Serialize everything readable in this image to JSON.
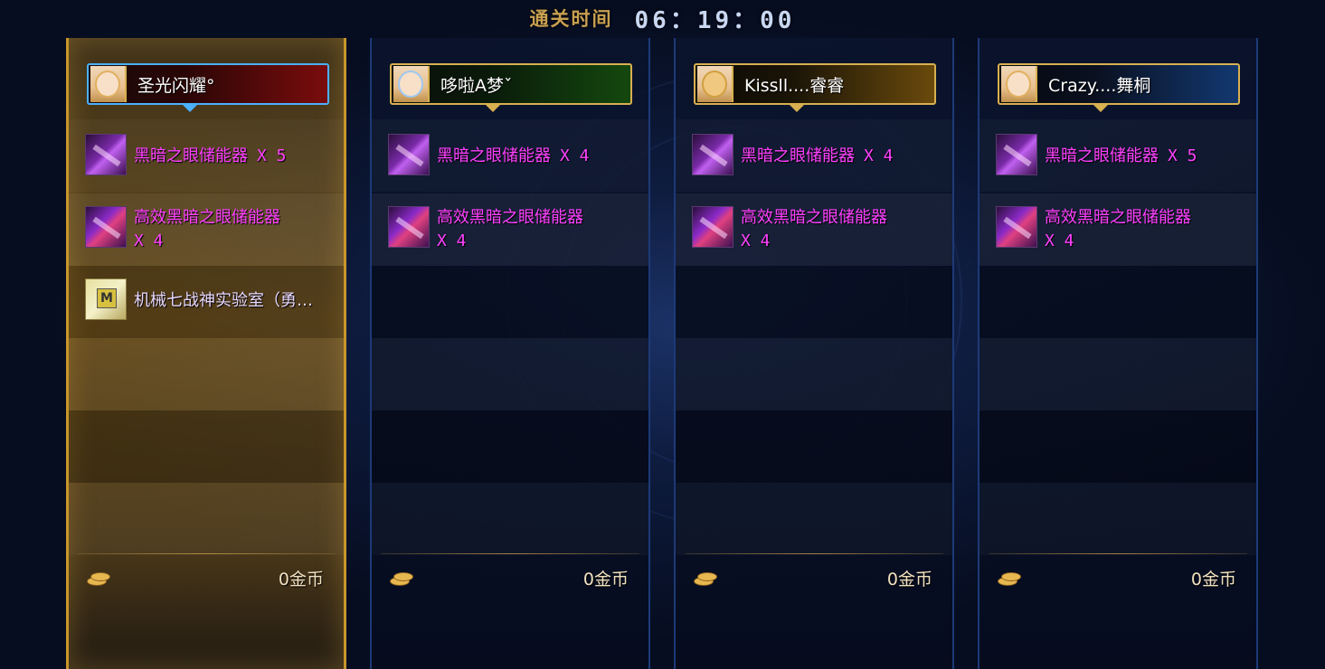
{
  "header": {
    "clear_label": "通关时间",
    "clear_time": "06：19：00"
  },
  "players": [
    {
      "name": "圣光闪耀°",
      "selected": true,
      "items": [
        {
          "name": "黑暗之眼储能器",
          "qty": "X 5",
          "icon": "dark-eye-storage-icon"
        },
        {
          "name": "高效黑暗之眼储能器",
          "qty": "X 4",
          "icon": "efficient-dark-eye-storage-icon"
        },
        {
          "name": "机械七战神实验室（勇…",
          "qty": "",
          "icon": "map-scroll-icon"
        }
      ],
      "gold": "0金币"
    },
    {
      "name": "哆啦A梦ˇ",
      "selected": false,
      "items": [
        {
          "name": "黑暗之眼储能器",
          "qty": "X 4",
          "icon": "dark-eye-storage-icon"
        },
        {
          "name": "高效黑暗之眼储能器",
          "qty": "X 4",
          "icon": "efficient-dark-eye-storage-icon"
        }
      ],
      "gold": "0金币"
    },
    {
      "name": "Kissll....睿睿",
      "selected": false,
      "items": [
        {
          "name": "黑暗之眼储能器",
          "qty": "X 4",
          "icon": "dark-eye-storage-icon"
        },
        {
          "name": "高效黑暗之眼储能器",
          "qty": "X 4",
          "icon": "efficient-dark-eye-storage-icon"
        }
      ],
      "gold": "0金币"
    },
    {
      "name": "Crazy....舞桐",
      "selected": false,
      "items": [
        {
          "name": "黑暗之眼储能器",
          "qty": "X 5",
          "icon": "dark-eye-storage-icon"
        },
        {
          "name": "高效黑暗之眼储能器",
          "qty": "X 4",
          "icon": "efficient-dark-eye-storage-icon"
        }
      ],
      "gold": "0金币"
    }
  ],
  "colors": {
    "item_rare": "#ff40ff",
    "selected_border": "#c8962a",
    "plate_border": "#d8b050",
    "plate_selected_border": "#4ab0ff"
  }
}
